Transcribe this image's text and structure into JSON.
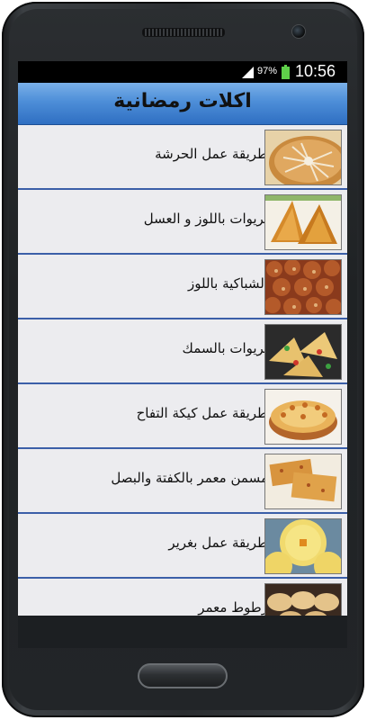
{
  "status_bar": {
    "battery_percent": "97%",
    "time": "10:56",
    "icons": [
      "signal-icon",
      "battery-icon"
    ]
  },
  "action_bar": {
    "title": "اكلات رمضانية"
  },
  "list": {
    "items": [
      {
        "label": "طريقة عمل الحرشة",
        "thumb": "harcha-image"
      },
      {
        "label": "بريوات باللوز و العسل",
        "thumb": "briouat-almond-honey-image"
      },
      {
        "label": "الشباكية باللوز",
        "thumb": "chebakia-almond-image"
      },
      {
        "label": "بريوات بالسمك",
        "thumb": "briouat-fish-image"
      },
      {
        "label": "طريقة عمل كيكة التفاح",
        "thumb": "apple-cake-image"
      },
      {
        "label": "مسمن معمر بالكفتة والبصل",
        "thumb": "msemen-kefta-onion-image"
      },
      {
        "label": "طريقة عمل بغرير",
        "thumb": "baghrir-image"
      },
      {
        "label": "رطوط معمر",
        "thumb": "stuffed-bread-image"
      }
    ]
  },
  "colors": {
    "action_bar_top": "#7ab0e8",
    "action_bar_bottom": "#2f6fc2",
    "row_divider": "#3b5fa8",
    "list_background": "#ececef"
  }
}
